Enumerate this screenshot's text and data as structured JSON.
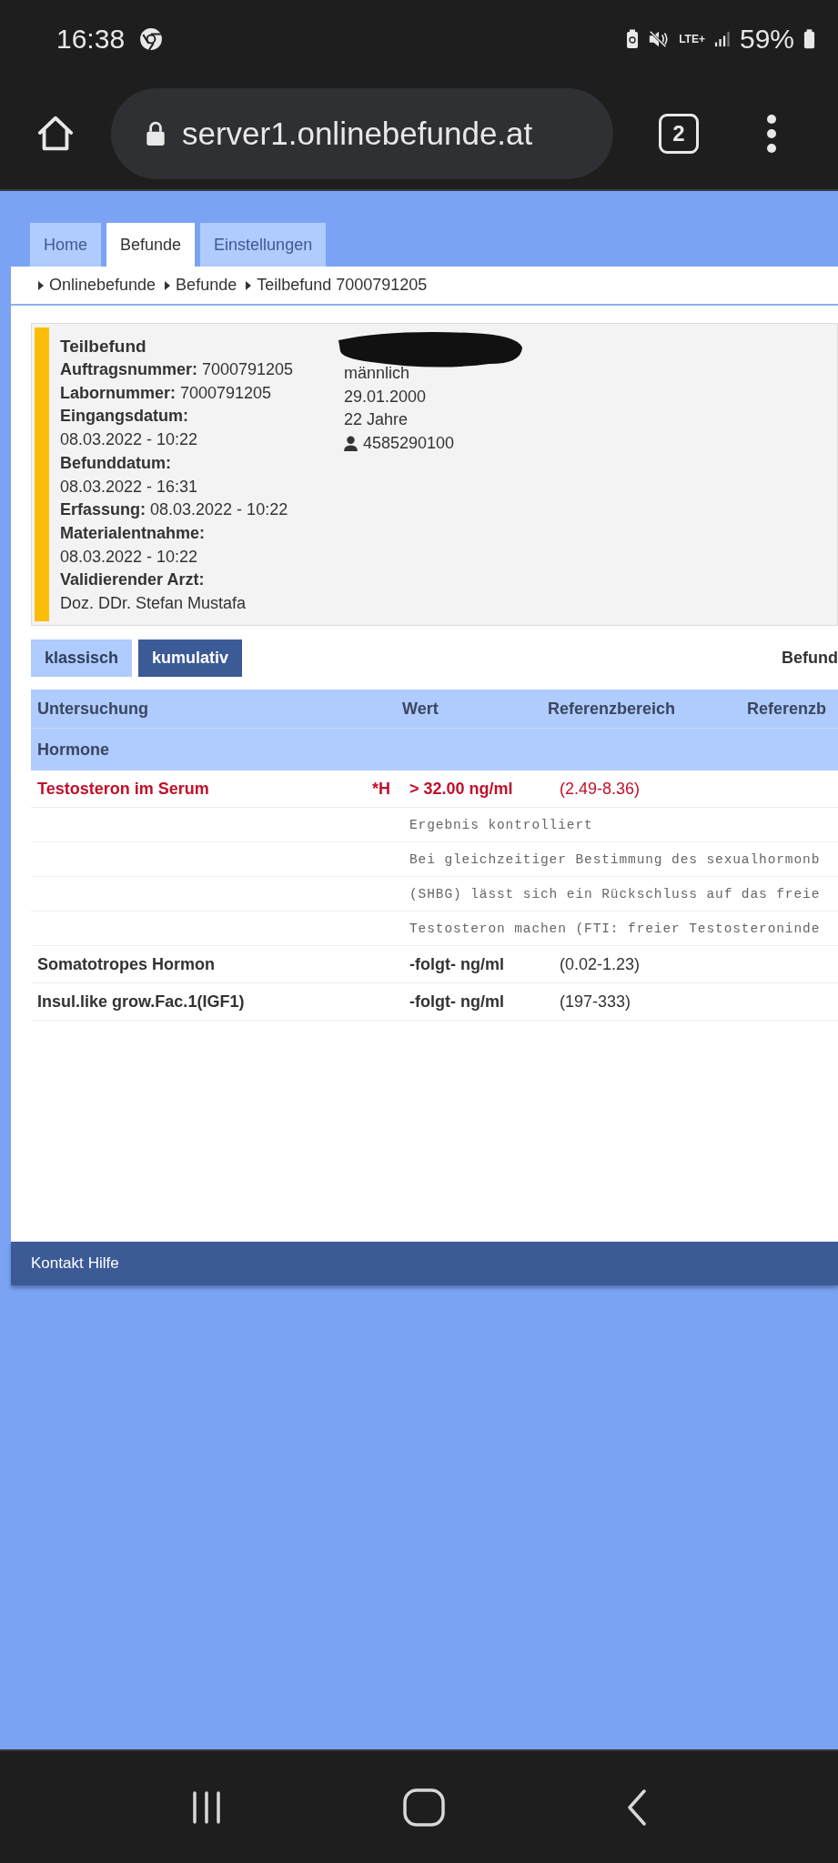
{
  "status_bar": {
    "time": "16:38",
    "network": "LTE+",
    "battery": "59%"
  },
  "browser": {
    "url": "server1.onlinebefunde.at",
    "tab_count": "2"
  },
  "tabs": [
    {
      "label": "Home",
      "selected": false
    },
    {
      "label": "Befunde",
      "selected": true
    },
    {
      "label": "Einstellungen",
      "selected": false
    }
  ],
  "breadcrumb": [
    "Onlinebefunde",
    "Befunde",
    "Teilbefund 7000791205"
  ],
  "report": {
    "title": "Teilbefund",
    "fields": [
      {
        "kind": "inline",
        "label": "Auftragsnummer:",
        "value": "7000791205"
      },
      {
        "kind": "inline",
        "label": "Labornummer:",
        "value": "7000791205"
      },
      {
        "kind": "stacked",
        "label": "Eingangsdatum:",
        "value": "08.03.2022 - 10:22"
      },
      {
        "kind": "stacked",
        "label": "Befunddatum:",
        "value": "08.03.2022 - 16:31"
      },
      {
        "kind": "inline",
        "label": "Erfassung:",
        "value": "08.03.2022 - 10:22"
      },
      {
        "kind": "stacked",
        "label": "Materialentnahme:",
        "value": "08.03.2022 - 10:22"
      },
      {
        "kind": "stacked",
        "label": "Validierender Arzt:",
        "value": "Doz. DDr. Stefan Mustafa"
      }
    ]
  },
  "patient": {
    "name_redacted": true,
    "lines": [
      "männlich",
      "29.01.2000",
      "22 Jahre"
    ],
    "id": "4585290100"
  },
  "view_buttons": [
    {
      "label": "klassisch",
      "selected": false
    },
    {
      "label": "kumulativ",
      "selected": true
    }
  ],
  "befund_label": "Befund",
  "table": {
    "columns": [
      "Untersuchung",
      "Wert",
      "Referenzbereich",
      "Referenzb"
    ],
    "group": "Hormone",
    "rows": [
      {
        "kind": "result",
        "name": "Testosteron im Serum",
        "flag": "*H",
        "value": "> 32.00 ng/ml",
        "range": "(2.49-8.36)",
        "abnormal": true
      },
      {
        "kind": "comment",
        "text": "Ergebnis kontrolliert"
      },
      {
        "kind": "comment",
        "text": "Bei gleichzeitiger Bestimmung des sexualhormonb"
      },
      {
        "kind": "comment",
        "text": "(SHBG) lässt sich ein Rückschluss auf das freie"
      },
      {
        "kind": "comment",
        "text": "Testosteron machen (FTI: freier Testosteroninde"
      },
      {
        "kind": "result",
        "name": "Somatotropes Hormon",
        "value": "-folgt- ng/ml",
        "range": "(0.02-1.23)",
        "abnormal": false
      },
      {
        "kind": "result",
        "name": "Insul.like grow.Fac.1(IGF1)",
        "value": "-folgt- ng/ml",
        "range": "(197-333)",
        "abnormal": false
      }
    ]
  },
  "footer": {
    "links": [
      "Kontakt",
      "Hilfe"
    ]
  }
}
